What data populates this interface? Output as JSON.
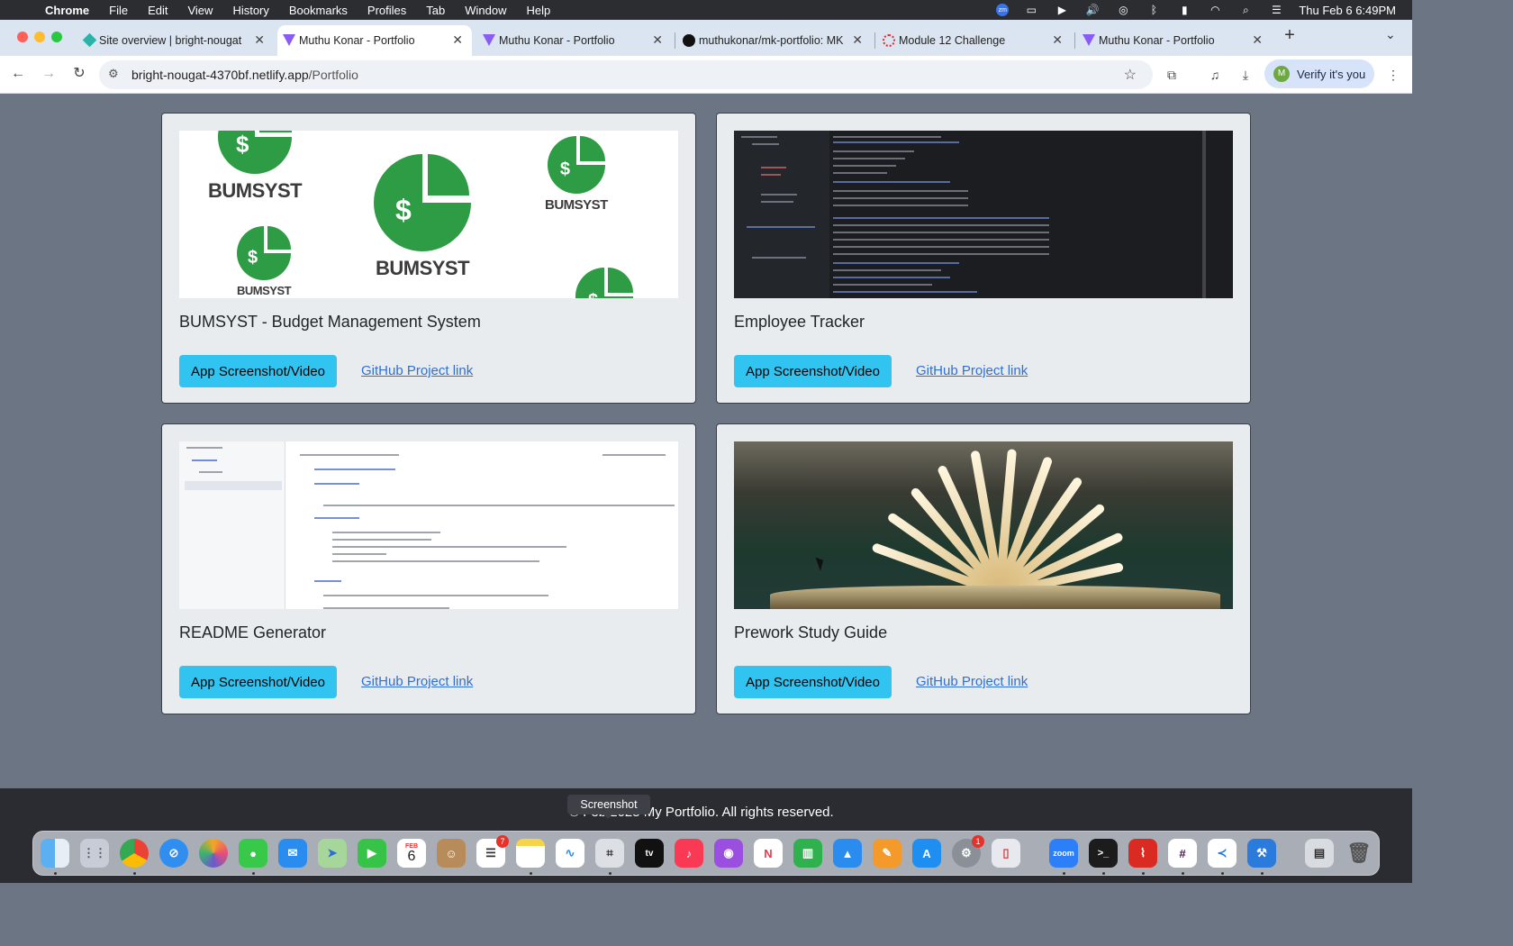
{
  "menubar": {
    "app": "Chrome",
    "items": [
      "File",
      "Edit",
      "View",
      "History",
      "Bookmarks",
      "Profiles",
      "Tab",
      "Window",
      "Help"
    ],
    "clock": "Thu Feb 6  6:49PM"
  },
  "tabs": [
    {
      "title": "Site overview | bright-nougat",
      "active": false
    },
    {
      "title": "Muthu Konar - Portfolio",
      "active": true
    },
    {
      "title": "Muthu Konar - Portfolio",
      "active": false
    },
    {
      "title": "muthukonar/mk-portfolio: MK",
      "active": false
    },
    {
      "title": "Module 12 Challenge",
      "active": false
    },
    {
      "title": "Muthu Konar - Portfolio",
      "active": false
    }
  ],
  "toolbar": {
    "url_host": "bright-nougat-4370bf.netlify.app",
    "url_path": "/Portfolio",
    "verify_label": "Verify it's you"
  },
  "projects": [
    {
      "title": "BUMSYST - Budget Management System",
      "button": "App Screenshot/Video",
      "link": "GitHub Project link",
      "thumb": "bumsyst-logo"
    },
    {
      "title": "Employee Tracker",
      "button": "App Screenshot/Video",
      "link": "GitHub Project link",
      "thumb": "terminal-screenshot"
    },
    {
      "title": "README Generator",
      "button": "App Screenshot/Video",
      "link": "GitHub Project link",
      "thumb": "code-editor-screenshot"
    },
    {
      "title": "Prework Study Guide",
      "button": "App Screenshot/Video",
      "link": "GitHub Project link",
      "thumb": "open-book-photo"
    }
  ],
  "thumbs": {
    "bumsyst_word": "BUMSYST",
    "dollar": "$"
  },
  "footer": {
    "copyright": "© Feb 2025 My Portfolio. All rights reserved."
  },
  "tooltip": "Screenshot",
  "dock": {
    "apps": [
      "finder-icon",
      "launchpad-icon",
      "chrome-icon",
      "safari-icon",
      "photos-icon",
      "messages-icon",
      "mail-icon",
      "maps-icon",
      "facetime-icon",
      "calendar-icon",
      "contacts-icon",
      "reminders-icon",
      "notes-icon",
      "freeform-icon",
      "screenshot-icon",
      "apple-tv-icon",
      "music-icon",
      "podcasts-icon",
      "news-icon",
      "numbers-icon",
      "keynote-icon",
      "pages-icon",
      "app-store-icon",
      "system-settings-icon",
      "preview-icon",
      "zoom-icon",
      "terminal-icon",
      "acrobat-icon",
      "slack-icon",
      "vscode-icon",
      "xcode-icon",
      "stocks-icon",
      "trash-icon"
    ],
    "calendar_month": "FEB",
    "calendar_day": "6",
    "reminders_badge": "7",
    "settings_badge": "1",
    "zoom_label": "zoom"
  },
  "colors": {
    "page_bg": "#6c7584",
    "card_bg": "#e9ecef",
    "button": "#31c4f0",
    "link": "#2f6fd6",
    "logo_green": "#2e9b45"
  }
}
